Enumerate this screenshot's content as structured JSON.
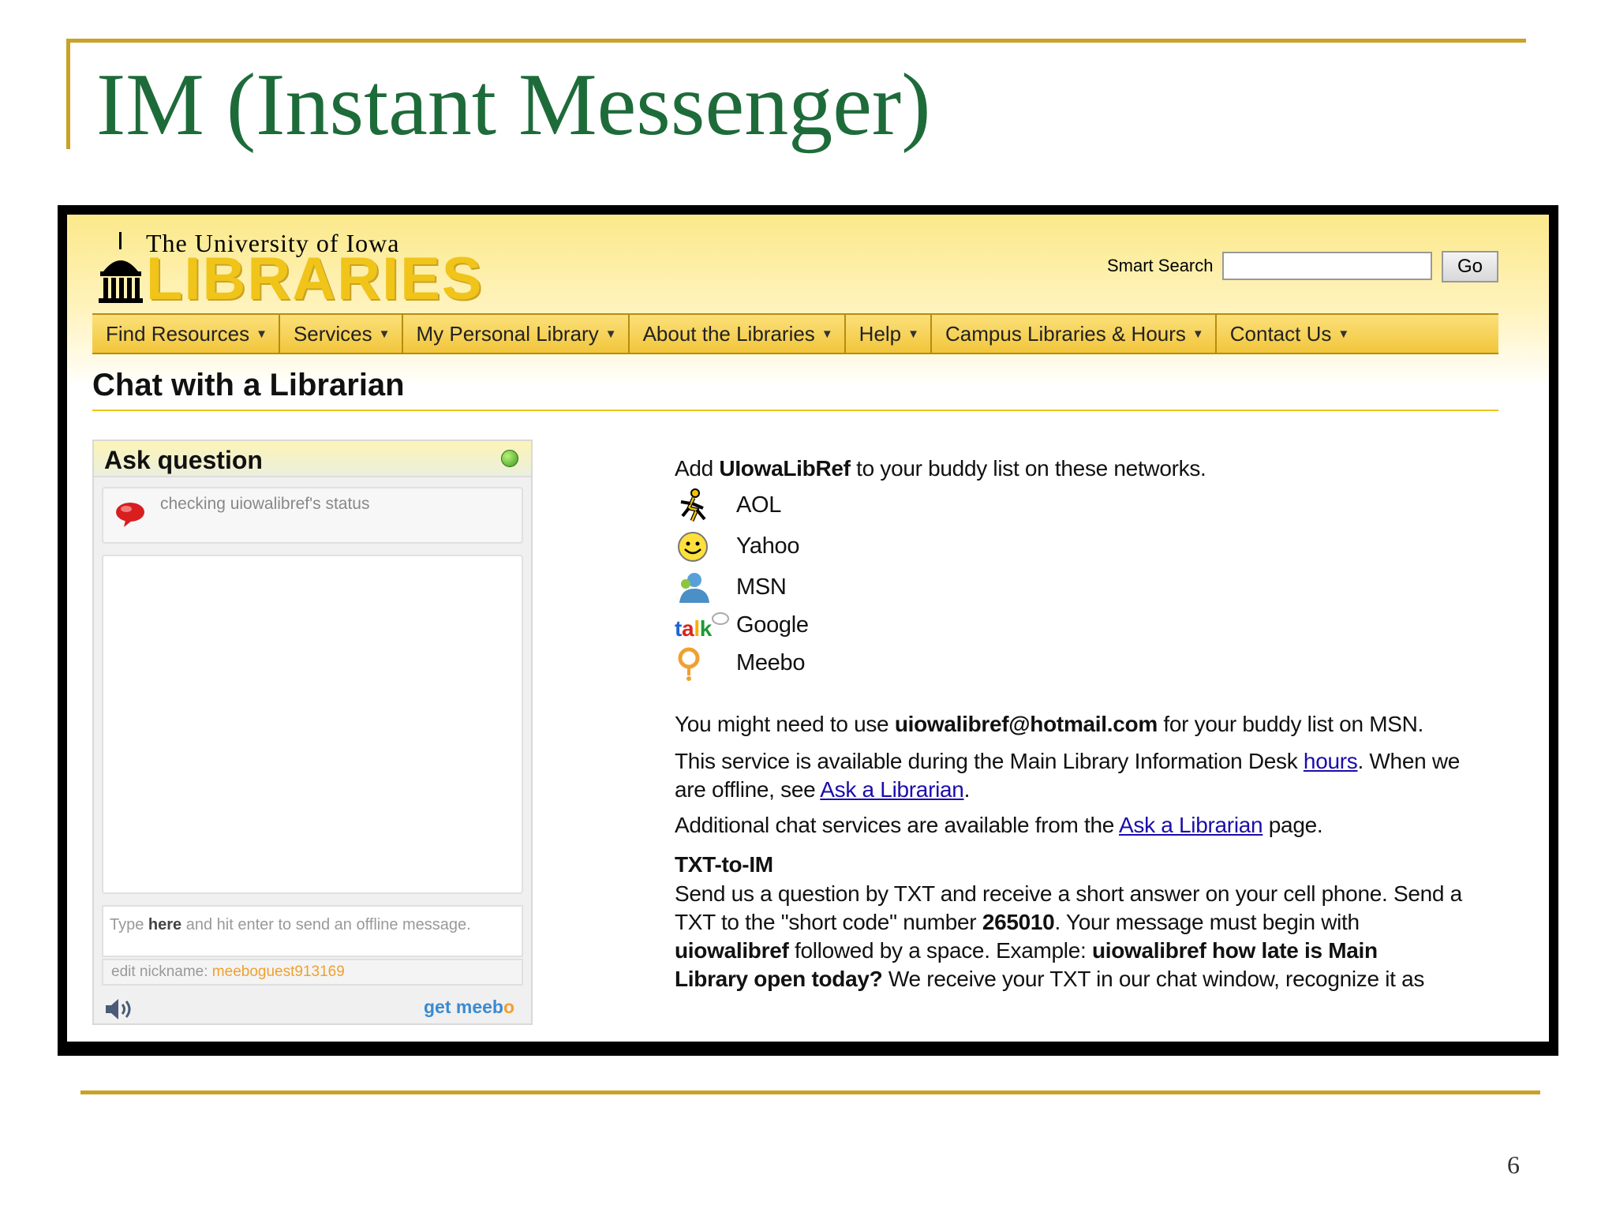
{
  "slide": {
    "title": "IM (Instant Messenger)",
    "page_number": "6"
  },
  "site": {
    "logo_line1": "The University of Iowa",
    "logo_line2": "LIBRARIES",
    "search_label": "Smart Search",
    "search_value": "",
    "go_label": "Go",
    "nav": [
      "Find Resources",
      "Services",
      "My Personal Library",
      "About the Libraries",
      "Help",
      "Campus Libraries & Hours",
      "Contact Us"
    ],
    "page_heading": "Chat with a Librarian"
  },
  "widget": {
    "title": "Ask question",
    "status": "checking uiowalibref's status",
    "input_prefix": "Type ",
    "input_bold": "here",
    "input_suffix": " and hit enter to send an offline message.",
    "nick_label": "edit nickname: ",
    "nick_value": "meeboguest913169",
    "brand_get": "get",
    "brand_meebo": "meeb",
    "brand_o": "o"
  },
  "content": {
    "intro_pre": "Add ",
    "intro_bold": "UIowaLibRef",
    "intro_post": " to your buddy list on these networks.",
    "networks": [
      {
        "label": "AOL",
        "icon": "aol-icon"
      },
      {
        "label": "Yahoo",
        "icon": "yahoo-icon"
      },
      {
        "label": "MSN",
        "icon": "msn-icon"
      },
      {
        "label": "Google",
        "icon": "google-talk-icon"
      },
      {
        "label": "Meebo",
        "icon": "meebo-icon"
      }
    ],
    "msn_pre": "You might need to use ",
    "msn_bold": "uiowalibref@hotmail.com",
    "msn_post": " for your buddy list on MSN.",
    "avail_1": "This service is available during the Main Library Information Desk ",
    "avail_link1": "hours",
    "avail_2": ". When we",
    "avail_3": "are offline, see ",
    "avail_link2": "Ask a Librarian",
    "avail_4": ".",
    "addl_pre": "Additional chat services are available from the ",
    "addl_link": "Ask a Librarian",
    "addl_post": " page.",
    "txt_heading": "TXT-to-IM",
    "txt_l1": "Send us a question by TXT and receive a short answer on your cell phone. Send a",
    "txt_l2_pre": "TXT to the \"short code\" number ",
    "txt_l2_bold": "265010",
    "txt_l2_post": ". Your message must begin with",
    "txt_l3_bold1": "uiowalibref",
    "txt_l3_mid": " followed by a space. Example: ",
    "txt_l3_bold2": "uiowalibref how late is Main",
    "txt_l4_bold": "Library open today?",
    "txt_l4_post": " We receive your TXT in our chat window, recognize it as"
  }
}
